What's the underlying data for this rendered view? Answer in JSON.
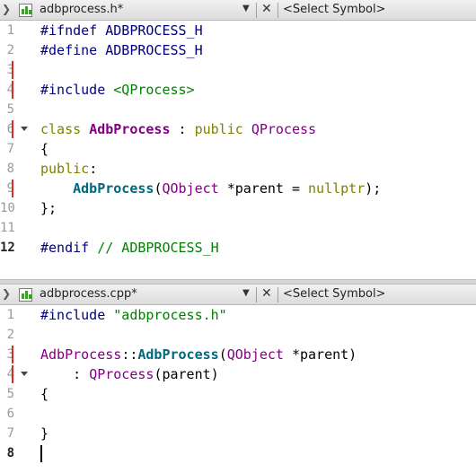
{
  "editor_top": {
    "tab": {
      "file_name": "adbprocess.h*",
      "symbol": "<Select Symbol>"
    },
    "lines": [
      {
        "n": "1",
        "tokens": [
          {
            "t": "#ifndef ADBPROCESS_H",
            "c": "pp"
          }
        ]
      },
      {
        "n": "2",
        "tokens": [
          {
            "t": "#define ADBPROCESS_H",
            "c": "pp"
          }
        ]
      },
      {
        "n": "3",
        "tokens": []
      },
      {
        "n": "4",
        "tokens": [
          {
            "t": "#include ",
            "c": "pp"
          },
          {
            "t": "<QProcess>",
            "c": "str"
          }
        ]
      },
      {
        "n": "5",
        "tokens": []
      },
      {
        "n": "6",
        "tokens": [
          {
            "t": "class ",
            "c": "kw"
          },
          {
            "t": "AdbProcess",
            "c": "cls bold"
          },
          {
            "t": " : ",
            "c": ""
          },
          {
            "t": "public ",
            "c": "kw"
          },
          {
            "t": "QProcess",
            "c": "cls"
          }
        ]
      },
      {
        "n": "7",
        "tokens": [
          {
            "t": "{",
            "c": ""
          }
        ]
      },
      {
        "n": "8",
        "tokens": [
          {
            "t": "public",
            "c": "kw"
          },
          {
            "t": ":",
            "c": ""
          }
        ]
      },
      {
        "n": "9",
        "tokens": [
          {
            "t": "    ",
            "c": ""
          },
          {
            "t": "AdbProcess",
            "c": "fn"
          },
          {
            "t": "(",
            "c": ""
          },
          {
            "t": "QObject",
            "c": "cls"
          },
          {
            "t": " *parent = ",
            "c": ""
          },
          {
            "t": "nullptr",
            "c": "kw"
          },
          {
            "t": ");",
            "c": ""
          }
        ]
      },
      {
        "n": "10",
        "tokens": [
          {
            "t": "};",
            "c": ""
          }
        ]
      },
      {
        "n": "11",
        "tokens": []
      },
      {
        "n": "12",
        "tokens": [
          {
            "t": "#endif ",
            "c": "pp"
          },
          {
            "t": "// ADBPROCESS_H",
            "c": "cmt"
          }
        ]
      }
    ]
  },
  "editor_bottom": {
    "tab": {
      "file_name": "adbprocess.cpp*",
      "symbol": "<Select Symbol>"
    },
    "lines": [
      {
        "n": "1",
        "tokens": [
          {
            "t": "#include ",
            "c": "pp"
          },
          {
            "t": "\"adbprocess.h\"",
            "c": "str"
          }
        ]
      },
      {
        "n": "2",
        "tokens": []
      },
      {
        "n": "3",
        "tokens": [
          {
            "t": "AdbProcess",
            "c": "cls"
          },
          {
            "t": "::",
            "c": ""
          },
          {
            "t": "AdbProcess",
            "c": "fn"
          },
          {
            "t": "(",
            "c": ""
          },
          {
            "t": "QObject",
            "c": "cls"
          },
          {
            "t": " *parent)",
            "c": ""
          }
        ]
      },
      {
        "n": "4",
        "tokens": [
          {
            "t": "    : ",
            "c": ""
          },
          {
            "t": "QProcess",
            "c": "cls"
          },
          {
            "t": "(parent)",
            "c": ""
          }
        ]
      },
      {
        "n": "5",
        "tokens": [
          {
            "t": "{",
            "c": ""
          }
        ]
      },
      {
        "n": "6",
        "tokens": []
      },
      {
        "n": "7",
        "tokens": [
          {
            "t": "}",
            "c": ""
          }
        ]
      },
      {
        "n": "8",
        "tokens": []
      }
    ]
  },
  "icons": {
    "nav": "chevron-right-icon",
    "file": "source-file-icon",
    "dropdown": "triangle-down-icon",
    "close": "close-icon"
  }
}
